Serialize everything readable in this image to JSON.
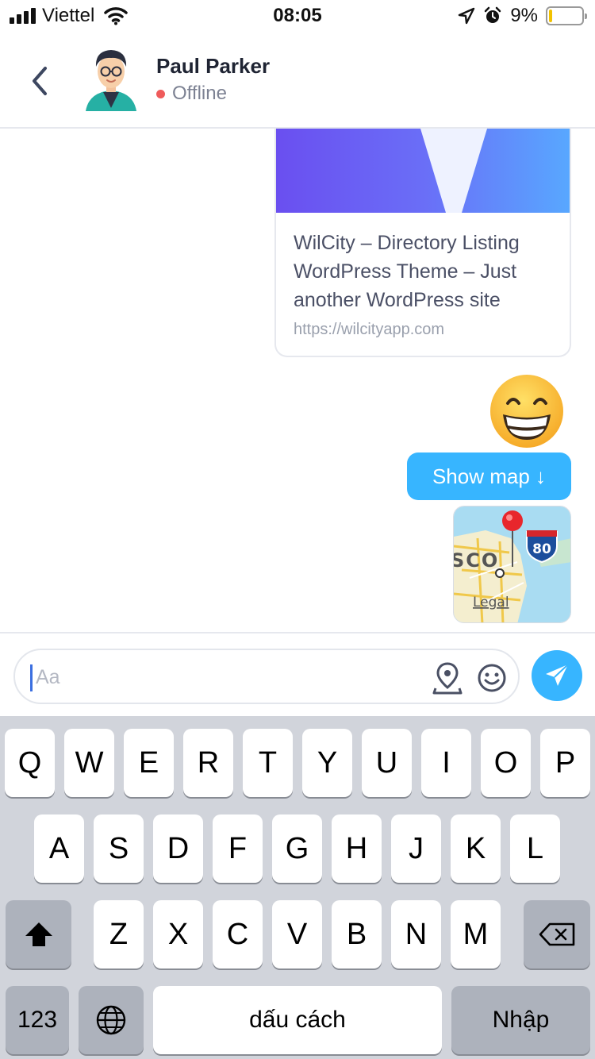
{
  "status_bar": {
    "carrier": "Viettel",
    "time": "08:05",
    "battery_percent": "9%",
    "battery_level": 0.09,
    "icons": [
      "signal-icon",
      "wifi-icon",
      "location-arrow-icon",
      "alarm-icon",
      "battery-icon"
    ]
  },
  "header": {
    "contact_name": "Paul Parker",
    "presence": "Offline",
    "presence_color": "#ef5b5b",
    "back_icon": "chevron-left-icon"
  },
  "messages": {
    "link_card": {
      "title": "WilCity – Directory Listing WordPress Theme – Just another WordPress site",
      "url": "https://wilcityapp.com"
    },
    "emoji": "grinning-face-emoji",
    "show_map_label": "Show map ↓",
    "map": {
      "city_fragment": "SCO",
      "route_shield": "80",
      "legal_label": "Legal"
    }
  },
  "composer": {
    "placeholder": "Aa",
    "icons": [
      "location-pin-icon",
      "smiley-icon",
      "send-icon"
    ],
    "accent_color": "#37b5ff"
  },
  "keyboard": {
    "row1": [
      "Q",
      "W",
      "E",
      "R",
      "T",
      "Y",
      "U",
      "I",
      "O",
      "P"
    ],
    "row2": [
      "A",
      "S",
      "D",
      "F",
      "G",
      "H",
      "J",
      "K",
      "L"
    ],
    "row3": [
      "Z",
      "X",
      "C",
      "V",
      "B",
      "N",
      "M"
    ],
    "numbers_label": "123",
    "space_label": "dấu cách",
    "return_label": "Nhập"
  }
}
